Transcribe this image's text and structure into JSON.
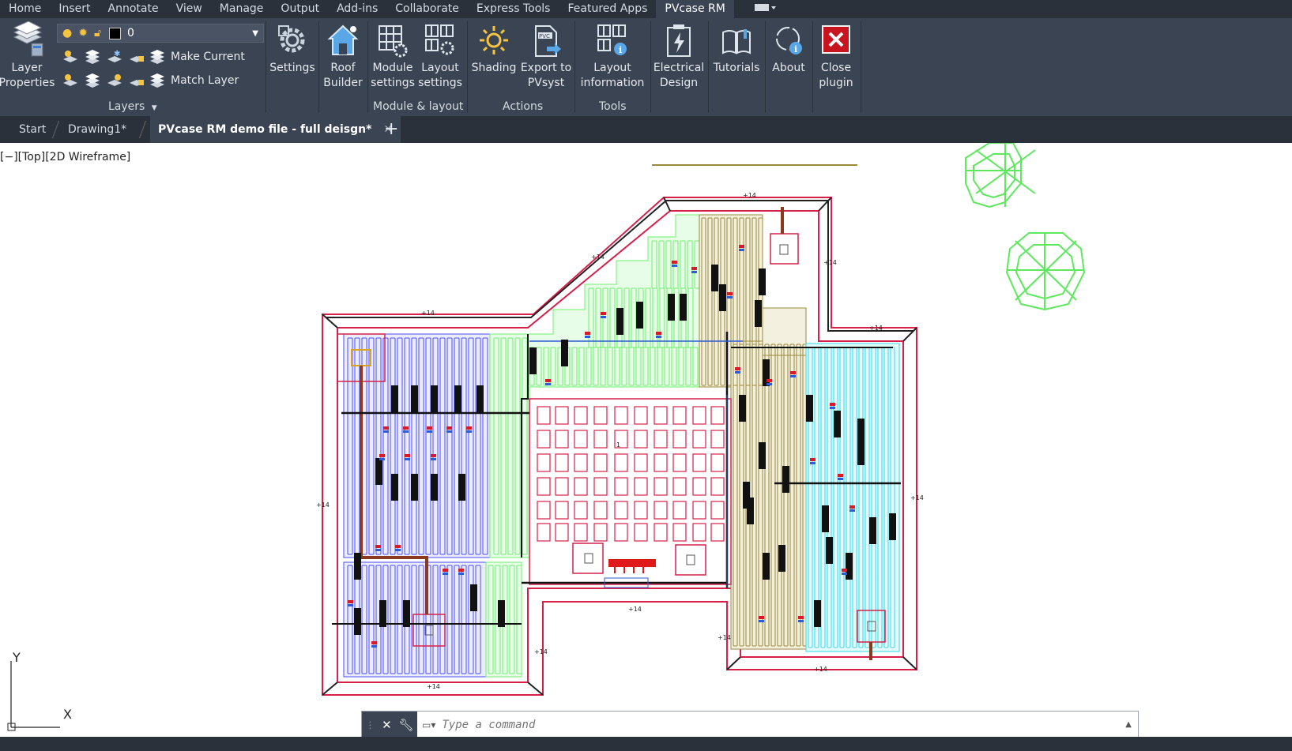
{
  "menu": {
    "items": [
      {
        "label": "Home"
      },
      {
        "label": "Insert"
      },
      {
        "label": "Annotate"
      },
      {
        "label": "View"
      },
      {
        "label": "Manage"
      },
      {
        "label": "Output"
      },
      {
        "label": "Add-ins"
      },
      {
        "label": "Collaborate"
      },
      {
        "label": "Express Tools"
      },
      {
        "label": "Featured Apps"
      },
      {
        "label": "PVcase RM"
      }
    ]
  },
  "layers": {
    "layer_properties_line1": "Layer",
    "layer_properties_line2": "Properties",
    "current_layer": "0",
    "make_current": "Make Current",
    "match_layer": "Match Layer",
    "panel_title": "Layers"
  },
  "ribbon": {
    "settings": "Settings",
    "roof_line1": "Roof",
    "roof_line2": "Builder",
    "module_line1": "Module",
    "module_line2": "settings",
    "layout_line1": "Layout",
    "layout_line2": "settings",
    "module_layout_title": "Module & layout",
    "shading": "Shading",
    "export_line1": "Export to",
    "export_line2": "PVsyst",
    "actions_title": "Actions",
    "layoutinfo_line1": "Layout",
    "layoutinfo_line2": "information",
    "tools_title": "Tools",
    "electrical_line1": "Electrical",
    "electrical_line2": "Design",
    "tutorials": "Tutorials",
    "about": "About",
    "close_line1": "Close",
    "close_line2": "plugin"
  },
  "tabs": {
    "start": "Start",
    "drawing1": "Drawing1*",
    "active": "PVcase RM demo file - full deisgn*"
  },
  "viewport": {
    "label": "[−][Top][2D Wireframe]",
    "axis_y": "Y",
    "axis_x": "X"
  },
  "command": {
    "placeholder": "Type a command"
  },
  "colors": {
    "menubar": "#2b313b",
    "ribbon": "#3b4453",
    "roof_outline": "#d6204a",
    "blue_modules": "#4b4bff",
    "green_modules": "#6cf06c",
    "olive_modules": "#9a8a3a",
    "cyan_modules": "#33d9e6",
    "trees": "#5ee85e"
  }
}
